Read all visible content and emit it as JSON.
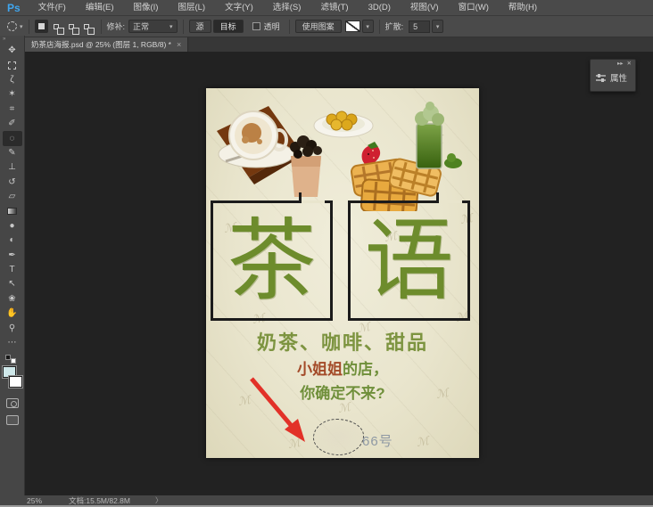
{
  "menu_bar": {
    "logo": "Ps",
    "items": [
      "文件(F)",
      "编辑(E)",
      "图像(I)",
      "图层(L)",
      "文字(Y)",
      "选择(S)",
      "滤镜(T)",
      "3D(D)",
      "视图(V)",
      "窗口(W)",
      "帮助(H)"
    ]
  },
  "options_bar": {
    "patch_label": "修补:",
    "patch_mode_value": "正常",
    "source_button": "源",
    "target_button": "目标",
    "transparent_label": "透明",
    "use_pattern_button": "使用图案",
    "diffusion_label": "扩散:",
    "diffusion_value": "5"
  },
  "tab_bar": {
    "document_tab_title": "奶茶店海报.psd @ 25% (图层 1, RGB/8) *"
  },
  "toolbar": {
    "tools": [
      {
        "name": "move",
        "glyph": "✥"
      },
      {
        "name": "rectangular-marquee",
        "glyph": ""
      },
      {
        "name": "lasso",
        "glyph": "ζ"
      },
      {
        "name": "quick-selection",
        "glyph": "✶"
      },
      {
        "name": "crop",
        "glyph": "⌗"
      },
      {
        "name": "eyedropper",
        "glyph": "✐"
      },
      {
        "name": "patch",
        "glyph": "◌"
      },
      {
        "name": "brush",
        "glyph": "✎"
      },
      {
        "name": "clone-stamp",
        "glyph": "⊥"
      },
      {
        "name": "history-brush",
        "glyph": "↺"
      },
      {
        "name": "eraser",
        "glyph": "▱"
      },
      {
        "name": "gradient",
        "glyph": ""
      },
      {
        "name": "blur",
        "glyph": "●"
      },
      {
        "name": "dodge",
        "glyph": "◐"
      },
      {
        "name": "pen",
        "glyph": "✒"
      },
      {
        "name": "type",
        "glyph": "T"
      },
      {
        "name": "path-selection",
        "glyph": "↖"
      },
      {
        "name": "custom-shape",
        "glyph": "❀"
      },
      {
        "name": "hand",
        "glyph": "✋"
      },
      {
        "name": "zoom",
        "glyph": "⚲"
      },
      {
        "name": "edit-toolbar",
        "glyph": "⋯"
      }
    ]
  },
  "canvas": {
    "poster": {
      "title_char_left": "茶",
      "title_char_right": "语",
      "subtitle": "奶茶、咖啡、甜品",
      "line2_highlight": "小姐姐",
      "line2_rest": "的店，",
      "line3": "你确定不来?",
      "address_fragment": "66号",
      "watermark_glyph": "ℳ"
    }
  },
  "panels": {
    "properties": {
      "label": "属性"
    }
  },
  "status_bar": {
    "zoom_level": "25%",
    "document_info": "文档:15.5M/82.8M"
  },
  "icons": {
    "caret_down": "▾",
    "chevron_right": "〉",
    "collapse_right": "▸▸",
    "close_x": "✕",
    "tab_close": "×",
    "toolbar_collapse": "»"
  },
  "colors": {
    "poster_bg": "#e9e5cd",
    "title_green": "#6d8c2c",
    "subtitle_green": "#7d9440",
    "highlight_red": "#a34a28",
    "arrow_red": "#e23128",
    "address_gray": "#8f99a4",
    "ui_gray": "#4a4a4a"
  }
}
